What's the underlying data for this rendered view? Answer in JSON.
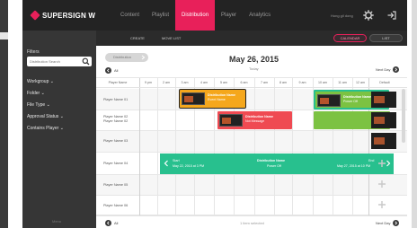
{
  "app": {
    "brand": "SUPERSIGN W",
    "brand_color": "#e8205a",
    "nav": [
      {
        "label": "Content",
        "active": false
      },
      {
        "label": "Playlist",
        "active": false
      },
      {
        "label": "Distribution",
        "active": true
      },
      {
        "label": "Player",
        "active": false
      },
      {
        "label": "Analytics",
        "active": false
      }
    ],
    "user": "Hong gil dong",
    "icons": [
      "gear-icon",
      "logout-icon"
    ]
  },
  "sidebar": {
    "title": "Filters",
    "search_placeholder": "Distribution Search",
    "filters": [
      "Workgroup",
      "Folder",
      "File Type",
      "Approval Status",
      "Contains Player"
    ],
    "footer": "Menu"
  },
  "subbar": {
    "create": "CREATE",
    "move_list": "MOVE LIST",
    "calendar": "CALENDAR",
    "list": "LIST",
    "active_view": "CALENDAR"
  },
  "calendar": {
    "back_label": "Distribution",
    "all_label": "All",
    "date_title": "May 26, 2015",
    "today": "Today",
    "next_day": "Next Day",
    "default_col": "Default",
    "player_col": "Player Name",
    "hours": [
      "9 pm",
      "2 am",
      "3 am",
      "4 am",
      "5 am",
      "6 am",
      "7 am",
      "8 am",
      "9 am",
      "10 am",
      "11 am",
      "12 am"
    ],
    "players": [
      "Player Name 01",
      "Player Name 02\nPlayer Name 02",
      "Player Name 03",
      "Player Name 04",
      "Player Name 05",
      "Player Name 06"
    ],
    "events": {
      "orange": {
        "title": "Distribution Name",
        "sub": "Event Name",
        "color": "#f5a71c"
      },
      "red": {
        "title": "Distribution Name",
        "sub": "Not Message",
        "color": "#ef4a52"
      },
      "green": {
        "title": "Distribution Name",
        "sub": "Power Off",
        "color": "#7cc242"
      },
      "long": {
        "start_label": "Start",
        "start_date": "May 22, 2015 at 3 PM",
        "title": "Distribution Name",
        "sub": "Power Off",
        "end_label": "End",
        "end_date": "May 27, 2015 at 10 PM",
        "color": "#28c08e"
      }
    },
    "footer_status": "1 item selected",
    "footer_all": "All",
    "footer_next": "Next Day"
  }
}
